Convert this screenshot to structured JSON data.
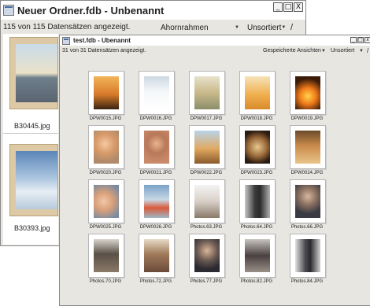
{
  "back_window": {
    "title": "Neuer Ordner.fdb - Unbenannt",
    "window_buttons": [
      "_",
      "□",
      "X"
    ],
    "status": "115 von 115 Datensätzen angezeigt.",
    "frame_select": "Ahornrahmen",
    "sort_select": "Unsortiert",
    "sort_direction": "/",
    "items": [
      {
        "filename": "B30445.jpg",
        "icon": "couple-beach-photo"
      },
      {
        "filename": "B30393.jpg",
        "icon": "sky-clouds-photo"
      }
    ]
  },
  "front_window": {
    "title": "test.fdb - Ubenannt",
    "window_buttons": [
      "_",
      "□",
      "x"
    ],
    "status": "31 von 31 Datensätzen angezeigt.",
    "views_select": "Gespeicherte Ansichten",
    "sort_select": "Unsortiert",
    "sort_direction": "/",
    "thumbnails": [
      {
        "filename": "DPW0015.JPG",
        "icon": "sunset-palms-photo"
      },
      {
        "filename": "DPW0016.JPG",
        "icon": "milk-glass-photo"
      },
      {
        "filename": "DPW0017.JPG",
        "icon": "cocktail-glass-photo"
      },
      {
        "filename": "DPW0018.JPG",
        "icon": "orange-drink-photo"
      },
      {
        "filename": "DPW0019.JPG",
        "icon": "fire-photo"
      },
      {
        "filename": "DPW0020.JPG",
        "icon": "child-portrait-photo"
      },
      {
        "filename": "DPW0021.JPG",
        "icon": "woman-portrait-photo"
      },
      {
        "filename": "DPW0022.JPG",
        "icon": "iced-tea-photo"
      },
      {
        "filename": "DPW0023.JPG",
        "icon": "plate-dish-photo"
      },
      {
        "filename": "DPW0024.JPG",
        "icon": "pastry-photo"
      },
      {
        "filename": "DPW0025.JPG",
        "icon": "children-faces-photo"
      },
      {
        "filename": "DPW0026.JPG",
        "icon": "food-bowl-photo"
      },
      {
        "filename": "Photos.63.JPG",
        "icon": "business-meeting-photo"
      },
      {
        "filename": "Photos.64.JPG",
        "icon": "man-standing-photo"
      },
      {
        "filename": "Photos.66.JPG",
        "icon": "man-portrait-photo"
      },
      {
        "filename": "Photos.70.JPG",
        "icon": "office-desk-photo"
      },
      {
        "filename": "Photos.72.JPG",
        "icon": "man-reading-photo"
      },
      {
        "filename": "Photos.77.JPG",
        "icon": "businessman-photo"
      },
      {
        "filename": "Photos.82.JPG",
        "icon": "woman-laptop-photo"
      },
      {
        "filename": "Photos.84.JPG",
        "icon": "man-suit-photo"
      }
    ]
  },
  "colors": {
    "window_bg": "#e8e6e1",
    "title_bg": "#ffffff",
    "maple_frame": "#ddc9a5"
  }
}
